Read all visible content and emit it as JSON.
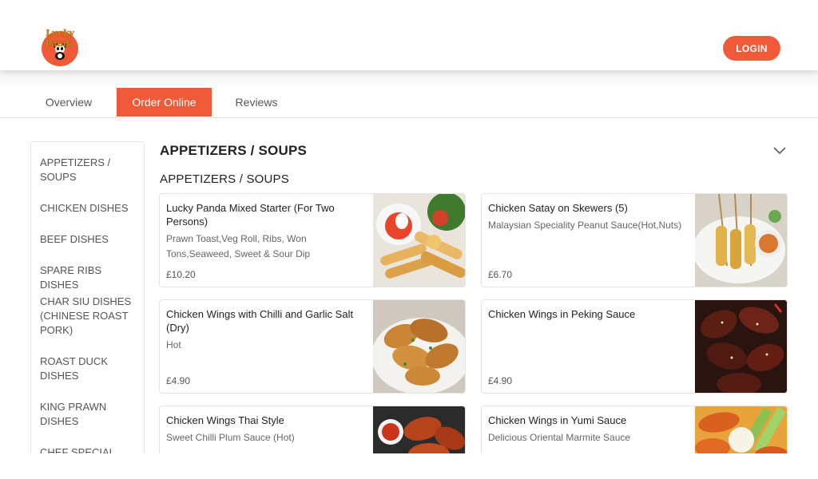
{
  "brand": {
    "logo_text": "Lucky Panda"
  },
  "header": {
    "login_label": "LOGIN"
  },
  "tabs": [
    {
      "label": "Overview"
    },
    {
      "label": "Order Online"
    },
    {
      "label": "Reviews"
    }
  ],
  "sidebar": {
    "categories": [
      "APPETIZERS / SOUPS",
      "CHICKEN DISHES",
      "BEEF DISHES",
      "SPARE RIBS DISHES",
      "CHAR SIU DISHES (CHINESE ROAST PORK)",
      "ROAST DUCK DISHES",
      "KING PRAWN DISHES",
      "CHEF SPECIAL"
    ]
  },
  "main": {
    "section_title": "APPETIZERS / SOUPS",
    "subsection_title": "APPETIZERS / SOUPS",
    "items": [
      {
        "name": "Lucky Panda Mixed Starter (For Two Persons)",
        "desc": "Prawn Toast,Veg Roll, Ribs, Won Tons,Seaweed, Sweet & Sour Dip",
        "price": "£10.20"
      },
      {
        "name": "Chicken Satay on Skewers (5)",
        "desc": "Malaysian Speciality Peanut Sauce(Hot,Nuts)",
        "price": "£6.70"
      },
      {
        "name": "Chicken Wings with Chilli and Garlic Salt (Dry)",
        "desc": "Hot",
        "price": "£4.90"
      },
      {
        "name": "Chicken Wings in Peking Sauce",
        "desc": "",
        "price": "£4.90"
      },
      {
        "name": "Chicken Wings Thai Style",
        "desc": "Sweet Chilli Plum Sauce (Hot)",
        "price": ""
      },
      {
        "name": "Chicken Wings in Yumi Sauce",
        "desc": "Delicious Oriental Marmite Sauce",
        "price": ""
      }
    ]
  },
  "colors": {
    "accent": "#f15a38",
    "text": "#222222",
    "muted": "#666666"
  }
}
